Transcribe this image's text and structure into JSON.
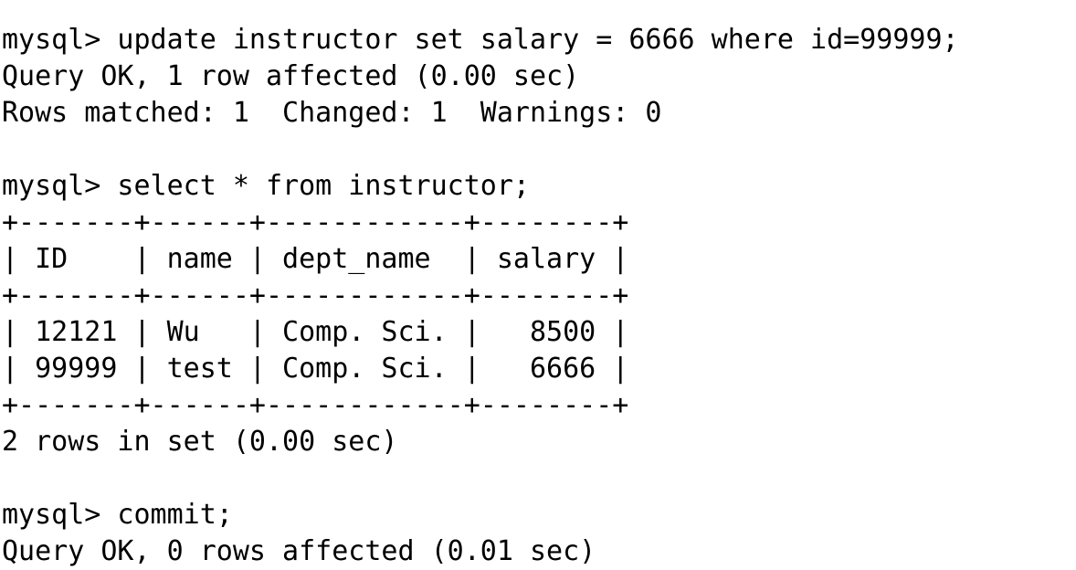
{
  "terminal": {
    "lines": [
      "",
      "mysql> update instructor set salary = 6666 where id=99999;",
      "Query OK, 1 row affected (0.00 sec)",
      "Rows matched: 1  Changed: 1  Warnings: 0",
      "",
      "mysql> select * from instructor;",
      "+-------+------+------------+--------+",
      "| ID    | name | dept_name  | salary |",
      "+-------+------+------------+--------+",
      "| 12121 | Wu   | Comp. Sci. |   8500 |",
      "| 99999 | test | Comp. Sci. |   6666 |",
      "+-------+------+------------+--------+",
      "2 rows in set (0.00 sec)",
      "",
      "mysql> commit;",
      "Query OK, 0 rows affected (0.01 sec)"
    ]
  }
}
